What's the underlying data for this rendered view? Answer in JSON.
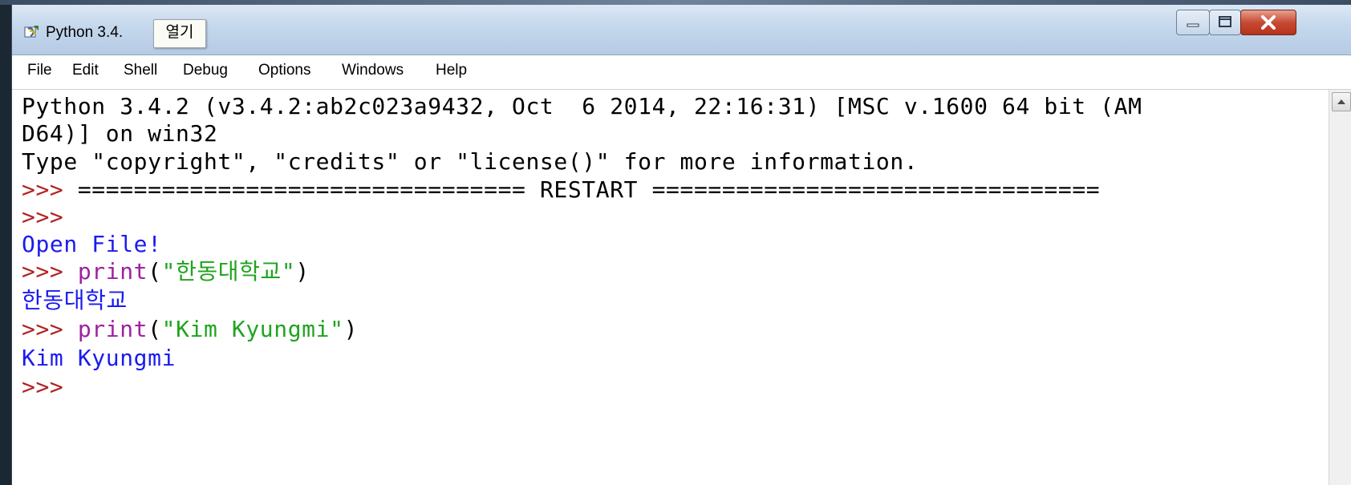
{
  "window": {
    "title": "Python 3.4.",
    "tooltip": "열기",
    "controls": {
      "minimize": "minimize",
      "maximize": "maximize",
      "close": "close"
    }
  },
  "menu": [
    "File",
    "Edit",
    "Shell",
    "Debug",
    "Options",
    "Windows",
    "Help"
  ],
  "shell": {
    "banner1": "Python 3.4.2 (v3.4.2:ab2c023a9432, Oct  6 2014, 22:16:31) [MSC v.1600 64 bit (AM",
    "banner2": "D64)] on win32",
    "banner3": "Type \"copyright\", \"credits\" or \"license()\" for more information.",
    "prompt": ">>> ",
    "restart_line": "================================ RESTART ================================",
    "output1": "Open File!",
    "cmd1_fn": "print",
    "cmd1_open": "(",
    "cmd1_str": "\"한동대학교\"",
    "cmd1_close": ")",
    "output2": "한동대학교",
    "cmd2_fn": "print",
    "cmd2_open": "(",
    "cmd2_str": "\"Kim Kyungmi\"",
    "cmd2_close": ")",
    "output3": "Kim Kyungmi"
  },
  "colors": {
    "prompt": "#b22222",
    "output": "#1b1bf0",
    "builtin": "#a020a0",
    "string": "#1fa41f",
    "text": "#000000"
  },
  "icons": {
    "app": "python-idle-icon",
    "scroll_up": "chevron-up-icon"
  }
}
